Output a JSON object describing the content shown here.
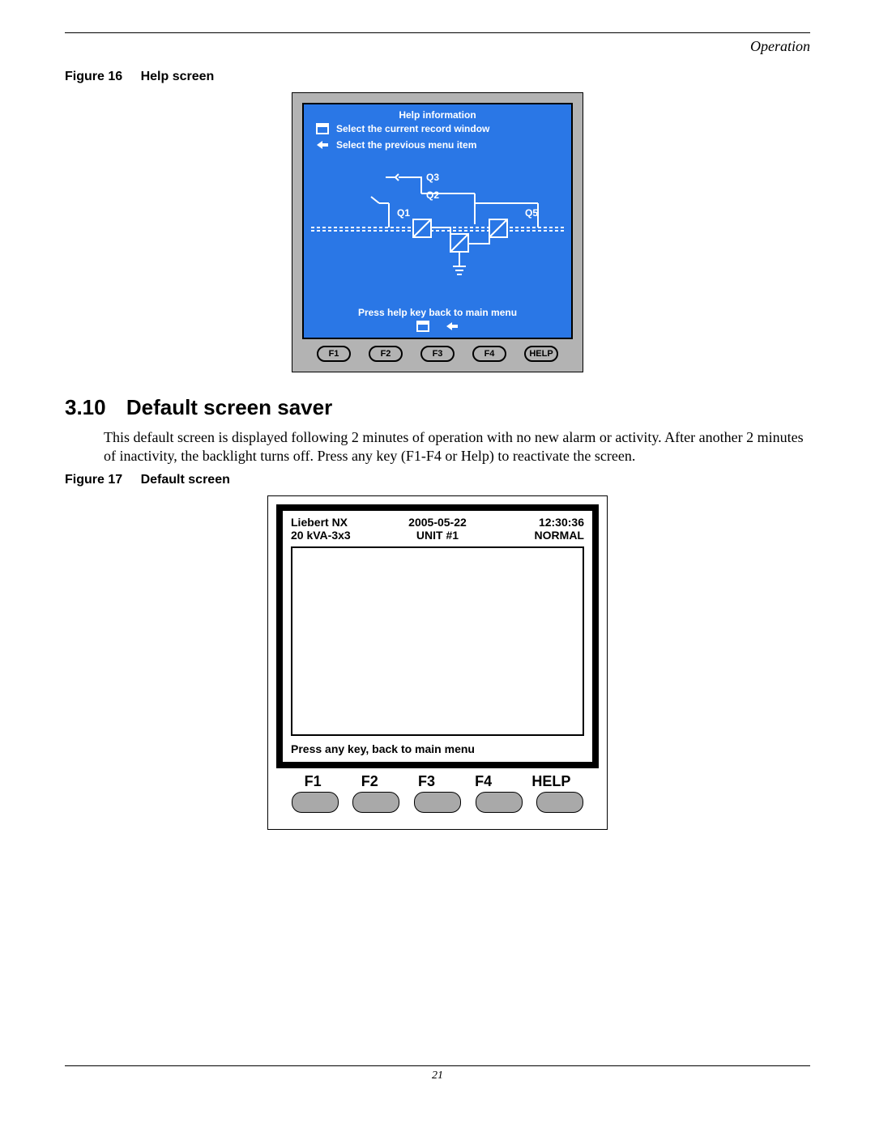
{
  "header": {
    "section": "Operation"
  },
  "figure16": {
    "label": "Figure 16",
    "caption": "Help screen",
    "screen": {
      "title": "Help information",
      "line1": "Select the current record window",
      "line2": "Select the previous menu item",
      "q_labels": {
        "q1": "Q1",
        "q2": "Q2",
        "q3": "Q3",
        "q5": "Q5"
      },
      "footer": "Press help key back to main menu",
      "buttons": [
        "F1",
        "F2",
        "F3",
        "F4",
        "HELP"
      ]
    }
  },
  "section_310": {
    "number": "3.10",
    "title": "Default screen saver",
    "body": "This default screen is displayed following 2 minutes of operation with no new alarm or activity. After another 2 minutes of inactivity, the backlight turns off. Press any key (F1-F4 or Help) to reactivate the screen."
  },
  "figure17": {
    "label": "Figure 17",
    "caption": "Default screen",
    "lcd": {
      "brand": "Liebert NX",
      "date": "2005-05-22",
      "time": "12:30:36",
      "model": "20 kVA-3x3",
      "unit": "UNIT #1",
      "status": "NORMAL",
      "prompt": "Press any key, back to main menu"
    },
    "keys": [
      "F1",
      "F2",
      "F3",
      "F4",
      "HELP"
    ]
  },
  "footer": {
    "page_number": "21"
  }
}
